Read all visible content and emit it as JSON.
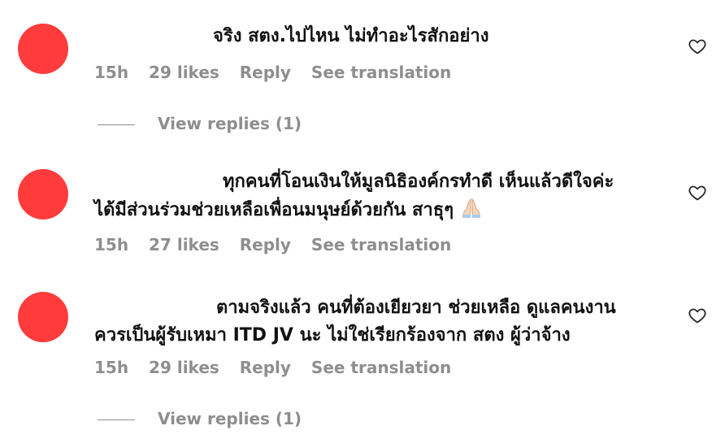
{
  "comments": [
    {
      "text_lines": [
        "จริง สตง.ไปไหน ไม่ทำอะไรสักอย่าง"
      ],
      "time": "15h",
      "likes": "29 likes",
      "reply": "Reply",
      "translate": "See translation",
      "view_replies": "View replies (1)"
    },
    {
      "text_lines": [
        "ทุกคนที่โอนเงินให้มูลนิธิองค์กรทำดี เห็นแล้วดีใจค่ะ",
        "ได้มีส่วนร่วมช่วยเหลือเพื่อนมนุษย์ด้วยกัน สาธุๆ"
      ],
      "emoji": "folded-hands-emoji",
      "time": "15h",
      "likes": "27 likes",
      "reply": "Reply",
      "translate": "See translation"
    },
    {
      "text_lines": [
        "ตามจริงแล้ว คนที่ต้องเยียวยา ช่วยเหลือ ดูแลคนงาน",
        "ควรเป็นผู้รับเหมา ITD JV นะ ไม่ใช่เรียกร้องจาก สตง ผู้ว่าจ้าง"
      ],
      "time": "15h",
      "likes": "29 likes",
      "reply": "Reply",
      "translate": "See translation",
      "view_replies": "View replies (1)"
    }
  ],
  "colors": {
    "avatar": "#ff3b3b",
    "muted": "#8e8e8e",
    "text": "#111111"
  }
}
